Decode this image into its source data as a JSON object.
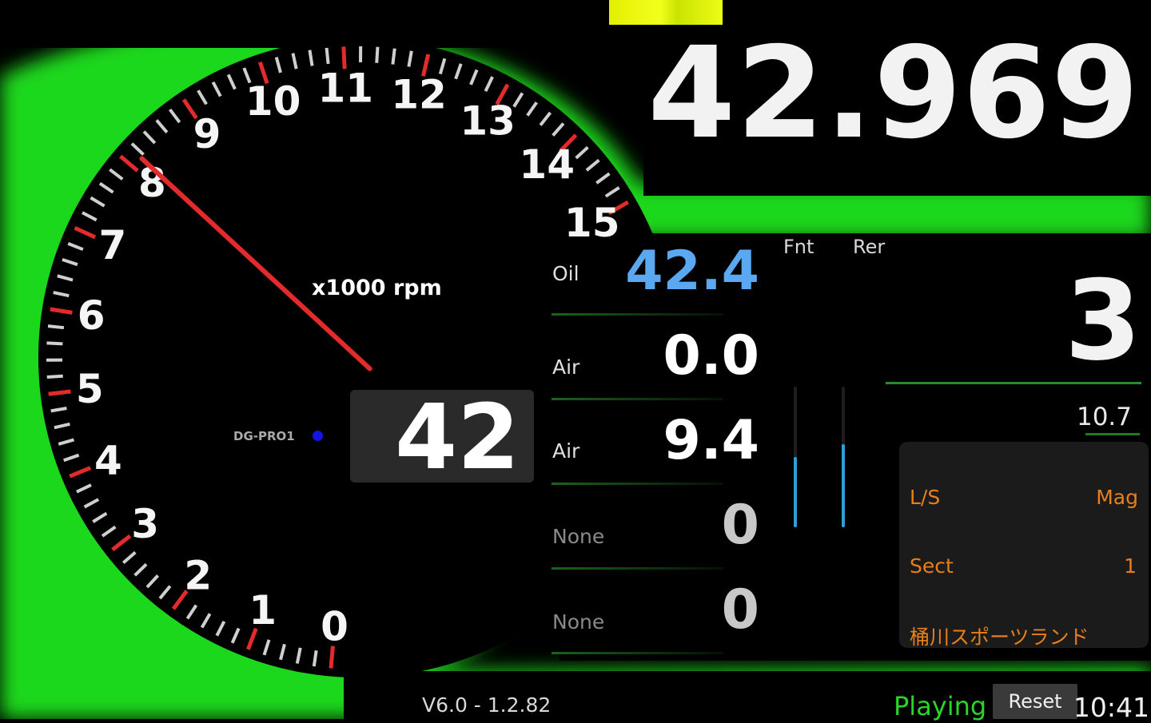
{
  "lap_time": "42.969",
  "tachometer": {
    "unit_label": "x1000 rpm",
    "device_label": "DG-PRO1",
    "tick_labels": [
      "0",
      "1",
      "2",
      "3",
      "4",
      "5",
      "6",
      "7",
      "8",
      "9",
      "10",
      "11",
      "12",
      "13",
      "14",
      "15"
    ],
    "needle_value": 8.15,
    "max_value": 15,
    "speed_value": "42"
  },
  "sensors": [
    {
      "label": "Oil",
      "value": "42.4"
    },
    {
      "label": "Air",
      "value": "0.0"
    },
    {
      "label": "Air",
      "value": "9.4"
    },
    {
      "label": "None",
      "value": "0"
    },
    {
      "label": "None",
      "value": "0"
    }
  ],
  "suspension": {
    "front_label": "Fnt",
    "rear_label": "Rer",
    "front_level": 0.5,
    "rear_level": 0.59
  },
  "gear_value": "3",
  "small_value": "10.7",
  "info_panel": {
    "ls_label": "L/S",
    "ls_value": "Mag",
    "sect_label": "Sect",
    "sect_value": "1",
    "track_name": "桶川スポーツランド"
  },
  "footer": {
    "version": "V6.0 - 1.2.82",
    "status": "Playing",
    "reset_label": "Reset",
    "clock": "10:41"
  },
  "colors": {
    "accent_green": "#1fd81f",
    "needle_red": "#e32b2b",
    "value_blue": "#5aa7f2",
    "info_orange": "#e87e1c",
    "status_green": "#2ad42a",
    "indicator_yellow": "#eaf40a"
  }
}
